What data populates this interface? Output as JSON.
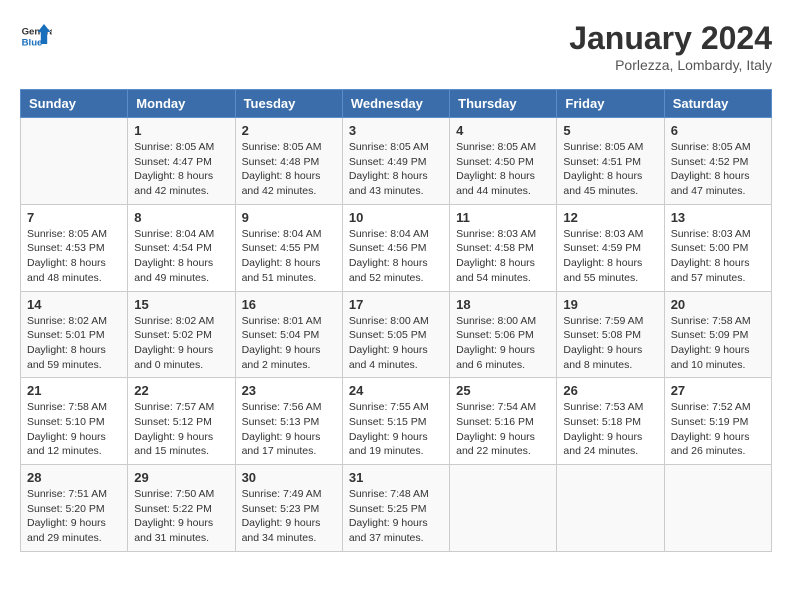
{
  "header": {
    "logo_general": "General",
    "logo_blue": "Blue",
    "main_title": "January 2024",
    "subtitle": "Porlezza, Lombardy, Italy"
  },
  "days_of_week": [
    "Sunday",
    "Monday",
    "Tuesday",
    "Wednesday",
    "Thursday",
    "Friday",
    "Saturday"
  ],
  "weeks": [
    [
      {
        "day": "",
        "info": ""
      },
      {
        "day": "1",
        "info": "Sunrise: 8:05 AM\nSunset: 4:47 PM\nDaylight: 8 hours\nand 42 minutes."
      },
      {
        "day": "2",
        "info": "Sunrise: 8:05 AM\nSunset: 4:48 PM\nDaylight: 8 hours\nand 42 minutes."
      },
      {
        "day": "3",
        "info": "Sunrise: 8:05 AM\nSunset: 4:49 PM\nDaylight: 8 hours\nand 43 minutes."
      },
      {
        "day": "4",
        "info": "Sunrise: 8:05 AM\nSunset: 4:50 PM\nDaylight: 8 hours\nand 44 minutes."
      },
      {
        "day": "5",
        "info": "Sunrise: 8:05 AM\nSunset: 4:51 PM\nDaylight: 8 hours\nand 45 minutes."
      },
      {
        "day": "6",
        "info": "Sunrise: 8:05 AM\nSunset: 4:52 PM\nDaylight: 8 hours\nand 47 minutes."
      }
    ],
    [
      {
        "day": "7",
        "info": "Sunrise: 8:05 AM\nSunset: 4:53 PM\nDaylight: 8 hours\nand 48 minutes."
      },
      {
        "day": "8",
        "info": "Sunrise: 8:04 AM\nSunset: 4:54 PM\nDaylight: 8 hours\nand 49 minutes."
      },
      {
        "day": "9",
        "info": "Sunrise: 8:04 AM\nSunset: 4:55 PM\nDaylight: 8 hours\nand 51 minutes."
      },
      {
        "day": "10",
        "info": "Sunrise: 8:04 AM\nSunset: 4:56 PM\nDaylight: 8 hours\nand 52 minutes."
      },
      {
        "day": "11",
        "info": "Sunrise: 8:03 AM\nSunset: 4:58 PM\nDaylight: 8 hours\nand 54 minutes."
      },
      {
        "day": "12",
        "info": "Sunrise: 8:03 AM\nSunset: 4:59 PM\nDaylight: 8 hours\nand 55 minutes."
      },
      {
        "day": "13",
        "info": "Sunrise: 8:03 AM\nSunset: 5:00 PM\nDaylight: 8 hours\nand 57 minutes."
      }
    ],
    [
      {
        "day": "14",
        "info": "Sunrise: 8:02 AM\nSunset: 5:01 PM\nDaylight: 8 hours\nand 59 minutes."
      },
      {
        "day": "15",
        "info": "Sunrise: 8:02 AM\nSunset: 5:02 PM\nDaylight: 9 hours\nand 0 minutes."
      },
      {
        "day": "16",
        "info": "Sunrise: 8:01 AM\nSunset: 5:04 PM\nDaylight: 9 hours\nand 2 minutes."
      },
      {
        "day": "17",
        "info": "Sunrise: 8:00 AM\nSunset: 5:05 PM\nDaylight: 9 hours\nand 4 minutes."
      },
      {
        "day": "18",
        "info": "Sunrise: 8:00 AM\nSunset: 5:06 PM\nDaylight: 9 hours\nand 6 minutes."
      },
      {
        "day": "19",
        "info": "Sunrise: 7:59 AM\nSunset: 5:08 PM\nDaylight: 9 hours\nand 8 minutes."
      },
      {
        "day": "20",
        "info": "Sunrise: 7:58 AM\nSunset: 5:09 PM\nDaylight: 9 hours\nand 10 minutes."
      }
    ],
    [
      {
        "day": "21",
        "info": "Sunrise: 7:58 AM\nSunset: 5:10 PM\nDaylight: 9 hours\nand 12 minutes."
      },
      {
        "day": "22",
        "info": "Sunrise: 7:57 AM\nSunset: 5:12 PM\nDaylight: 9 hours\nand 15 minutes."
      },
      {
        "day": "23",
        "info": "Sunrise: 7:56 AM\nSunset: 5:13 PM\nDaylight: 9 hours\nand 17 minutes."
      },
      {
        "day": "24",
        "info": "Sunrise: 7:55 AM\nSunset: 5:15 PM\nDaylight: 9 hours\nand 19 minutes."
      },
      {
        "day": "25",
        "info": "Sunrise: 7:54 AM\nSunset: 5:16 PM\nDaylight: 9 hours\nand 22 minutes."
      },
      {
        "day": "26",
        "info": "Sunrise: 7:53 AM\nSunset: 5:18 PM\nDaylight: 9 hours\nand 24 minutes."
      },
      {
        "day": "27",
        "info": "Sunrise: 7:52 AM\nSunset: 5:19 PM\nDaylight: 9 hours\nand 26 minutes."
      }
    ],
    [
      {
        "day": "28",
        "info": "Sunrise: 7:51 AM\nSunset: 5:20 PM\nDaylight: 9 hours\nand 29 minutes."
      },
      {
        "day": "29",
        "info": "Sunrise: 7:50 AM\nSunset: 5:22 PM\nDaylight: 9 hours\nand 31 minutes."
      },
      {
        "day": "30",
        "info": "Sunrise: 7:49 AM\nSunset: 5:23 PM\nDaylight: 9 hours\nand 34 minutes."
      },
      {
        "day": "31",
        "info": "Sunrise: 7:48 AM\nSunset: 5:25 PM\nDaylight: 9 hours\nand 37 minutes."
      },
      {
        "day": "",
        "info": ""
      },
      {
        "day": "",
        "info": ""
      },
      {
        "day": "",
        "info": ""
      }
    ]
  ]
}
